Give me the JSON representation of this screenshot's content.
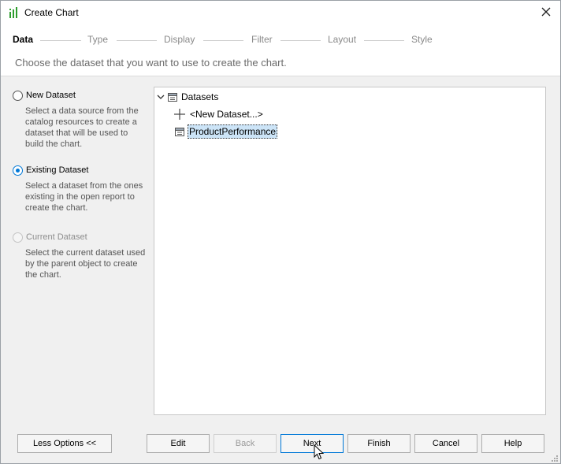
{
  "window": {
    "title": "Create Chart"
  },
  "wizard": {
    "steps": [
      "Data",
      "Type",
      "Display",
      "Filter",
      "Layout",
      "Style"
    ],
    "active_step": "Data",
    "subtitle": "Choose the dataset that you want to use to create the chart."
  },
  "options": [
    {
      "label": "New Dataset",
      "description": "Select a data source from the catalog resources to create a dataset that will be used to build the chart.",
      "checked": false,
      "disabled": false
    },
    {
      "label": "Existing Dataset",
      "description": "Select a dataset from the ones existing in the open report to create the chart.",
      "checked": true,
      "disabled": false
    },
    {
      "label": "Current Dataset",
      "description": "Select the current dataset used by the parent object to create the chart.",
      "checked": false,
      "disabled": true
    }
  ],
  "tree": {
    "root_label": "Datasets",
    "new_dataset_label": "<New Dataset...>",
    "dataset_label": "ProductPerformance",
    "selected": "ProductPerformance",
    "expanded": true
  },
  "buttons": {
    "less_options": "Less Options <<",
    "edit": "Edit",
    "back": "Back",
    "next": "Next",
    "finish": "Finish",
    "cancel": "Cancel",
    "help": "Help"
  },
  "colors": {
    "accent": "#0078d7",
    "selection": "#cce4f7",
    "app_icon": "#2e9e2e"
  },
  "icons": {
    "app": "chart-bars-icon",
    "close": "close-icon",
    "expand": "chevron-down-icon",
    "root": "dataset-icon",
    "new": "plus-icon",
    "dataset": "dataset-icon"
  }
}
